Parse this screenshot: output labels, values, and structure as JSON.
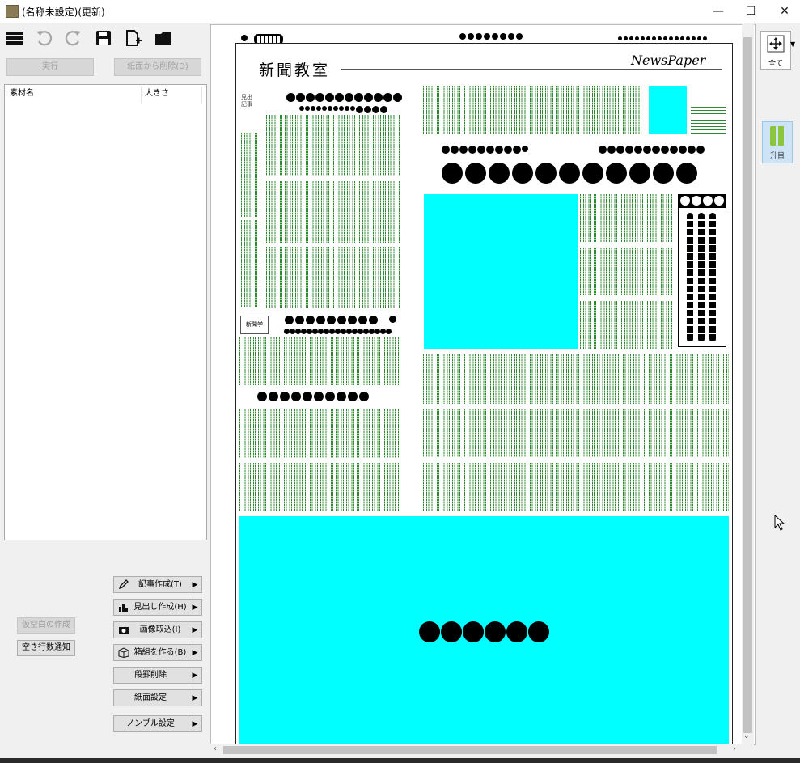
{
  "window": {
    "title": "(名称未設定)(更新)",
    "controls": {
      "minimize": "—",
      "maximize": "☐",
      "close": "✕"
    }
  },
  "toolbar": {
    "icons": [
      "menu-icon",
      "undo-icon",
      "redo-icon",
      "save-icon",
      "new-page-icon",
      "open-folder-icon"
    ],
    "run_label": "実行",
    "remove_label": "紙面から削除(D)"
  },
  "material_list": {
    "columns": [
      "素材名",
      "大きさ"
    ],
    "rows": []
  },
  "actions": [
    {
      "label": "記事作成(T)",
      "icon": "pencil-icon"
    },
    {
      "label": "見出し作成(H)",
      "icon": "bar-chart-icon"
    },
    {
      "label": "画像取込(I)",
      "icon": "camera-icon"
    },
    {
      "label": "箱組を作る(B)",
      "icon": "box-icon"
    },
    {
      "label": "段罫削除",
      "icon": ""
    },
    {
      "label": "紙面設定",
      "icon": ""
    },
    {
      "label": "ノンブル設定",
      "icon": ""
    }
  ],
  "side_buttons": {
    "provisional": "仮空白の作成",
    "notify": "空き行数通知"
  },
  "paper": {
    "masthead": "新聞教室",
    "brand": "NewsPaper",
    "mini_labels": [
      "見出",
      "記事",
      "新聞学"
    ]
  },
  "right_rail": {
    "fit_label": "全て",
    "view_label": "升目"
  },
  "colors": {
    "image_placeholder": "#00ffff",
    "grid": "#2f8a2f",
    "view_selected": "#cde4f7"
  }
}
